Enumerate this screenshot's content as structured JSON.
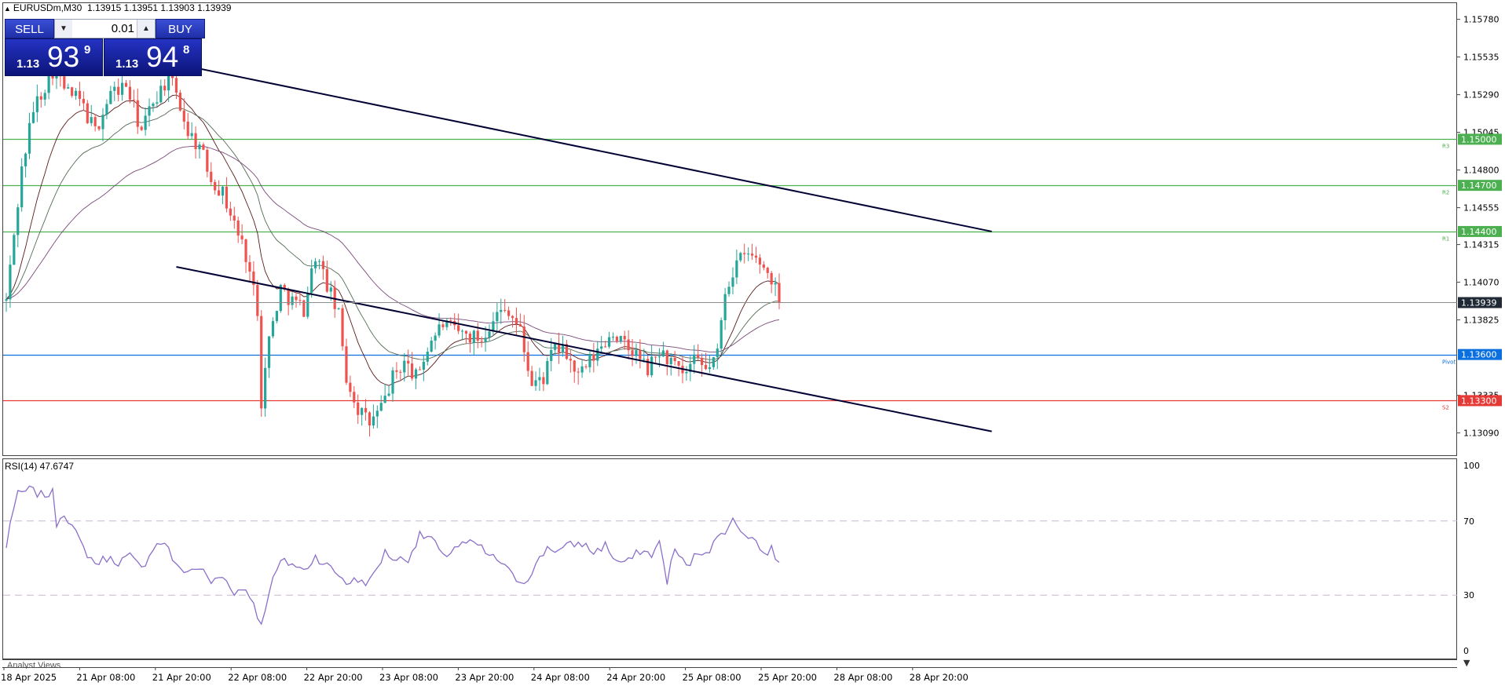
{
  "header": {
    "symbol": "EURUSDm,M30",
    "ohlc": "1.13915 1.13951 1.13903 1.13939"
  },
  "trade_panel": {
    "sell_label": "SELL",
    "buy_label": "BUY",
    "lot_value": "0.01",
    "bid": {
      "small": "1.13",
      "big": "93",
      "sup": "9"
    },
    "ask": {
      "small": "1.13",
      "big": "94",
      "sup": "8"
    }
  },
  "analyst_label": "Analyst Views",
  "colors": {
    "bull": "#26a69a",
    "bear": "#ef5350",
    "resistance": "#4caf50",
    "pivot": "#0b6fe0",
    "support": "#e53935",
    "rsi": "#8b6fc8",
    "ma_fast": "#5a1a1a",
    "ma_mid": "#556b55",
    "ma_slow": "#7a4a7a",
    "trendline": "#000033"
  },
  "chart_data": {
    "type": "candlestick",
    "symbol": "EURUSDm",
    "timeframe": "M30",
    "ylim": [
      1.1295,
      1.1588
    ],
    "y_ticks": [
      "1.15780",
      "1.15535",
      "1.15290",
      "1.15045",
      "1.14800",
      "1.14555",
      "1.14315",
      "1.14070",
      "1.13825",
      "1.13335",
      "1.13090"
    ],
    "x_ticks": [
      "18 Apr 2025",
      "21 Apr 08:00",
      "21 Apr 20:00",
      "22 Apr 08:00",
      "22 Apr 20:00",
      "23 Apr 08:00",
      "23 Apr 20:00",
      "24 Apr 08:00",
      "24 Apr 20:00",
      "25 Apr 08:00",
      "25 Apr 20:00",
      "28 Apr 08:00",
      "28 Apr 20:00"
    ],
    "current_price": "1.13939",
    "levels": [
      {
        "label": "1.15000",
        "value": 1.15,
        "tag": "R3",
        "kind": "resistance"
      },
      {
        "label": "1.14700",
        "value": 1.147,
        "tag": "R2",
        "kind": "resistance"
      },
      {
        "label": "1.14400",
        "value": 1.144,
        "tag": "R1",
        "kind": "resistance"
      },
      {
        "label": "1.13600",
        "value": 1.136,
        "tag": "Pivot",
        "kind": "pivot"
      },
      {
        "label": "1.13300",
        "value": 1.133,
        "tag": "S2",
        "kind": "support"
      }
    ],
    "trendlines": [
      {
        "from": [
          44,
          1.1549
        ],
        "to": [
          255,
          1.144
        ]
      },
      {
        "from": [
          44,
          1.1417
        ],
        "to": [
          255,
          1.131
        ]
      }
    ],
    "close_path": [
      [
        0,
        1.1395
      ],
      [
        4,
        1.148
      ],
      [
        7,
        1.152
      ],
      [
        12,
        1.1545
      ],
      [
        16,
        1.153
      ],
      [
        19,
        1.1525
      ],
      [
        23,
        1.1505
      ],
      [
        27,
        1.153
      ],
      [
        31,
        1.1535
      ],
      [
        35,
        1.1505
      ],
      [
        38,
        1.1525
      ],
      [
        42,
        1.154
      ],
      [
        44,
        1.153
      ],
      [
        47,
        1.1505
      ],
      [
        50,
        1.1495
      ],
      [
        53,
        1.1475
      ],
      [
        56,
        1.1465
      ],
      [
        59,
        1.1445
      ],
      [
        62,
        1.1425
      ],
      [
        65,
        1.139
      ],
      [
        66,
        1.133
      ],
      [
        68,
        1.137
      ],
      [
        71,
        1.1403
      ],
      [
        74,
        1.1395
      ],
      [
        77,
        1.139
      ],
      [
        80,
        1.1425
      ],
      [
        83,
        1.1405
      ],
      [
        86,
        1.1385
      ],
      [
        88,
        1.1345
      ],
      [
        91,
        1.1325
      ],
      [
        94,
        1.1315
      ],
      [
        97,
        1.1325
      ],
      [
        100,
        1.1345
      ],
      [
        103,
        1.1355
      ],
      [
        106,
        1.1345
      ],
      [
        110,
        1.137
      ],
      [
        113,
        1.138
      ],
      [
        116,
        1.1375
      ],
      [
        120,
        1.1372
      ],
      [
        123,
        1.137
      ],
      [
        126,
        1.1385
      ],
      [
        130,
        1.139
      ],
      [
        133,
        1.1375
      ],
      [
        136,
        1.134
      ],
      [
        139,
        1.1345
      ],
      [
        142,
        1.1365
      ],
      [
        145,
        1.136
      ],
      [
        148,
        1.1345
      ],
      [
        151,
        1.1355
      ],
      [
        154,
        1.1365
      ],
      [
        157,
        1.1375
      ],
      [
        160,
        1.1365
      ],
      [
        163,
        1.136
      ],
      [
        166,
        1.135
      ],
      [
        169,
        1.1362
      ],
      [
        172,
        1.1355
      ],
      [
        175,
        1.1345
      ],
      [
        178,
        1.1355
      ],
      [
        181,
        1.135
      ],
      [
        184,
        1.136
      ],
      [
        186,
        1.1402
      ],
      [
        189,
        1.142
      ],
      [
        192,
        1.1425
      ],
      [
        195,
        1.142
      ],
      [
        198,
        1.141
      ],
      [
        200,
        1.1394
      ]
    ],
    "rsi": {
      "label": "RSI(14) 47.6747",
      "period": 14,
      "value": 47.6747,
      "ylim": [
        0,
        100
      ],
      "y_ticks": [
        "100",
        "70",
        "30",
        "0"
      ],
      "levels": [
        70,
        30
      ],
      "path": [
        [
          0,
          55
        ],
        [
          1,
          70
        ],
        [
          3,
          84
        ],
        [
          6,
          87
        ],
        [
          9,
          84
        ],
        [
          12,
          85
        ],
        [
          13,
          69
        ],
        [
          15,
          75
        ],
        [
          17,
          67
        ],
        [
          20,
          55
        ],
        [
          23,
          47
        ],
        [
          26,
          50
        ],
        [
          29,
          48
        ],
        [
          32,
          51
        ],
        [
          35,
          44
        ],
        [
          38,
          56
        ],
        [
          41,
          59
        ],
        [
          44,
          45
        ],
        [
          47,
          43
        ],
        [
          50,
          45
        ],
        [
          53,
          37
        ],
        [
          56,
          40
        ],
        [
          59,
          32
        ],
        [
          62,
          33
        ],
        [
          64,
          26
        ],
        [
          66,
          13
        ],
        [
          68,
          33
        ],
        [
          71,
          48
        ],
        [
          74,
          47
        ],
        [
          77,
          43
        ],
        [
          80,
          51
        ],
        [
          83,
          46
        ],
        [
          86,
          41
        ],
        [
          88,
          37
        ],
        [
          91,
          38
        ],
        [
          94,
          37
        ],
        [
          96,
          45
        ],
        [
          98,
          53
        ],
        [
          101,
          49
        ],
        [
          104,
          50
        ],
        [
          107,
          62
        ],
        [
          110,
          61
        ],
        [
          113,
          50
        ],
        [
          116,
          56
        ],
        [
          119,
          58
        ],
        [
          122,
          57
        ],
        [
          125,
          51
        ],
        [
          128,
          48
        ],
        [
          131,
          40
        ],
        [
          134,
          37
        ],
        [
          137,
          46
        ],
        [
          140,
          56
        ],
        [
          143,
          54
        ],
        [
          146,
          57
        ],
        [
          149,
          58
        ],
        [
          152,
          53
        ],
        [
          155,
          57
        ],
        [
          158,
          48
        ],
        [
          161,
          48
        ],
        [
          164,
          54
        ],
        [
          167,
          52
        ],
        [
          169,
          58
        ],
        [
          171,
          38
        ],
        [
          173,
          55
        ],
        [
          176,
          45
        ],
        [
          179,
          53
        ],
        [
          182,
          55
        ],
        [
          185,
          63
        ],
        [
          188,
          70
        ],
        [
          191,
          64
        ],
        [
          194,
          59
        ],
        [
          196,
          52
        ],
        [
          198,
          55
        ],
        [
          200,
          47.67
        ]
      ]
    }
  }
}
